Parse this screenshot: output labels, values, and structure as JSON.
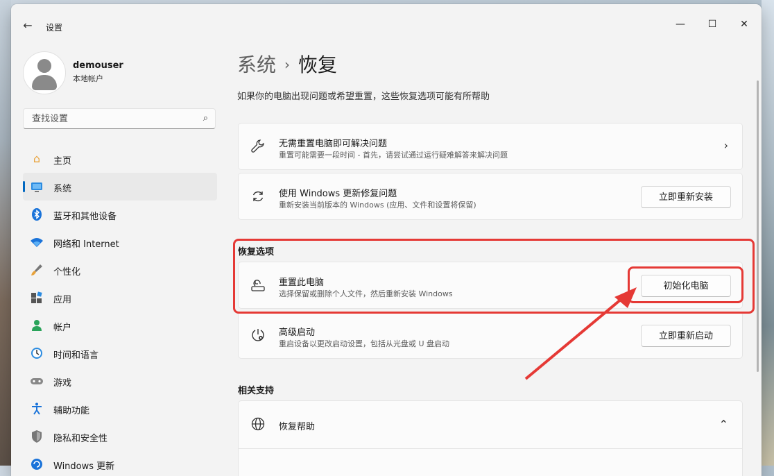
{
  "window": {
    "title": "设置",
    "minimize_glyph": "—",
    "maximize_glyph": "☐",
    "close_glyph": "✕",
    "back_glyph": "←"
  },
  "user": {
    "name": "demouser",
    "account_type": "本地帐户"
  },
  "search": {
    "placeholder": "查找设置",
    "icon": "search-icon"
  },
  "sidebar": {
    "items": [
      {
        "label": "主页",
        "icon": "home-icon",
        "glyph": "🏠",
        "active": false
      },
      {
        "label": "系统",
        "icon": "monitor-icon",
        "glyph": "▬",
        "active": true
      },
      {
        "label": "蓝牙和其他设备",
        "icon": "bluetooth-icon",
        "glyph": "ᛒ",
        "active": false
      },
      {
        "label": "网络和 Internet",
        "icon": "wifi-icon",
        "glyph": "◆",
        "active": false
      },
      {
        "label": "个性化",
        "icon": "brush-icon",
        "glyph": "🖌",
        "active": false
      },
      {
        "label": "应用",
        "icon": "apps-icon",
        "glyph": "▦",
        "active": false
      },
      {
        "label": "帐户",
        "icon": "person-icon",
        "glyph": "●",
        "active": false
      },
      {
        "label": "时间和语言",
        "icon": "clock-globe-icon",
        "glyph": "◷",
        "active": false
      },
      {
        "label": "游戏",
        "icon": "gamepad-icon",
        "glyph": "🎮",
        "active": false
      },
      {
        "label": "辅助功能",
        "icon": "accessibility-icon",
        "glyph": "♿",
        "active": false
      },
      {
        "label": "隐私和安全性",
        "icon": "shield-icon",
        "glyph": "⛉",
        "active": false
      },
      {
        "label": "Windows 更新",
        "icon": "update-icon",
        "glyph": "↻",
        "active": false
      }
    ]
  },
  "main": {
    "breadcrumb_parent": "系统",
    "breadcrumb_sep": "›",
    "breadcrumb_current": "恢复",
    "description": "如果你的电脑出现问题或希望重置，这些恢复选项可能有所帮助",
    "cards": {
      "troubleshoot": {
        "title": "无需重置电脑即可解决问题",
        "subtitle": "重置可能需要一段时间 - 首先，请尝试通过运行疑难解答来解决问题",
        "icon": "wrench-icon",
        "chevron": "›"
      },
      "windows_update_fix": {
        "title": "使用 Windows 更新修复问题",
        "subtitle": "重新安装当前版本的 Windows (应用、文件和设置将保留)",
        "icon": "refresh-icon",
        "button": "立即重新安装"
      }
    },
    "recovery_options": {
      "header": "恢复选项",
      "reset": {
        "title": "重置此电脑",
        "subtitle": "选择保留或删除个人文件，然后重新安装 Windows",
        "icon": "reset-pc-icon",
        "button": "初始化电脑"
      },
      "advanced": {
        "title": "高级启动",
        "subtitle": "重启设备以更改启动设置，包括从光盘或 U 盘启动",
        "icon": "advanced-startup-icon",
        "button": "立即重新启动"
      }
    },
    "related": {
      "header": "相关支持",
      "help": {
        "title": "恢复帮助",
        "icon": "globe-icon",
        "chevron": "⌃"
      }
    }
  },
  "colors": {
    "accent": "#0067c0",
    "highlight": "#e53935"
  }
}
